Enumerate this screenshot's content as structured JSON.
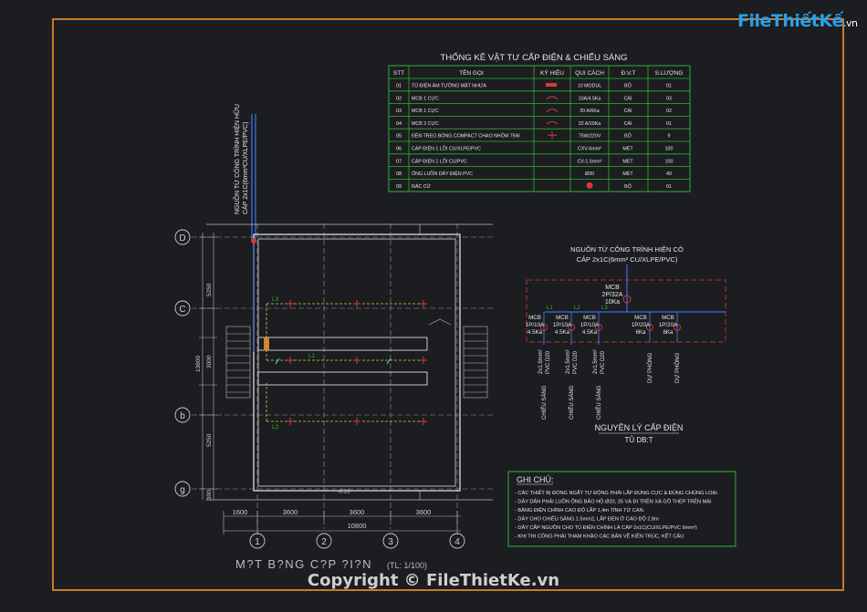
{
  "logo": {
    "brand": "FileThiếtKế",
    "suffix": ".vn"
  },
  "copyright": "Copyright © FileThietKe.vn",
  "table": {
    "title": "THỐNG KÊ VẬT TƯ CẤP ĐIỆN & CHIẾU SÁNG",
    "headers": [
      "STT",
      "TÊN GỌI",
      "KÝ HIỆU",
      "QUI CÁCH",
      "Đ.V.T",
      "S.LƯỢNG"
    ],
    "rows": [
      {
        "stt": "01",
        "name": "TỦ ĐIỆN ÂM TƯỜNG MẶT NHỰA",
        "spec": "10 MODUL",
        "unit": "BỘ",
        "qty": "01"
      },
      {
        "stt": "02",
        "name": "MCB 1 CỰC",
        "spec": "10A/4.5Ka",
        "unit": "CÁI",
        "qty": "03"
      },
      {
        "stt": "03",
        "name": "MCB 1 CỰC",
        "spec": "20 A/6Ka",
        "unit": "CÁI",
        "qty": "02"
      },
      {
        "stt": "04",
        "name": "MCB 2 CỰC",
        "spec": "32 A/10Ka",
        "unit": "CÁI",
        "qty": "01"
      },
      {
        "stt": "05",
        "name": "ĐÈN TREO BÓNG COMPACT CHAO NHÔM 75W",
        "spec": "75W/220V",
        "unit": "BỘ",
        "qty": "9"
      },
      {
        "stt": "06",
        "name": "CÁP ĐIỆN 1 LÕI CU/XLPE/PVC",
        "spec": "CXV-6mm²",
        "unit": "MÉT",
        "qty": "100"
      },
      {
        "stt": "07",
        "name": "CÁP ĐIỆN 1 LÕI CU/PVC",
        "spec": "CV-1.5mm²",
        "unit": "MÉT",
        "qty": "100"
      },
      {
        "stt": "08",
        "name": "ỐNG LUỒN DÂY ĐIỆN PVC",
        "spec": "Ø20",
        "unit": "MÉT",
        "qty": "40"
      },
      {
        "stt": "09",
        "name": "RÁC CỬ",
        "spec": "",
        "unit": "BỘ",
        "qty": "01"
      }
    ]
  },
  "plan": {
    "title": "M?T B?NG C?P ?I?N",
    "scale": "(TL: 1/100)",
    "level": "-0.20",
    "source_note_1": "NGUỒN TỪ CÔNG TRÌNH HIỆN HỮU",
    "source_note_2": "CÁP 2x1C(6mm²CU/XLPE/PVC)",
    "row_axes": [
      "D",
      "C",
      "b",
      "g"
    ],
    "col_axes": [
      "1",
      "2",
      "3",
      "4"
    ],
    "dims_x": [
      "1600",
      "3600",
      "3600",
      "3600"
    ],
    "dim_total_x": "10800",
    "dims_y": [
      "5250",
      "3000",
      "5250",
      "300"
    ],
    "dim_total_y": "13800",
    "circuit_tags": [
      "L3",
      "L1",
      "L2"
    ]
  },
  "schematic": {
    "source_1": "NGUỒN TỪ CÔNG TRÌNH HIỆN CÓ",
    "source_2": "CÁP 2x1C(6mm² CU/XLPE/PVC)",
    "main": [
      "MCB",
      "2P/32A",
      "10Ka"
    ],
    "lines": [
      "L1",
      "L2",
      "L3"
    ],
    "branches": [
      {
        "l1": "MCB",
        "l2": "1P/10A",
        "l3": "4.5Ka",
        "cable": "2x1.5mm²",
        "pipe": "PVC D20",
        "load": "CHIẾU SÁNG"
      },
      {
        "l1": "MCB",
        "l2": "1P/10A",
        "l3": "4.5Ka",
        "cable": "2x1.5mm²",
        "pipe": "PVC D20",
        "load": "CHIẾU SÁNG"
      },
      {
        "l1": "MCB",
        "l2": "1P/10A",
        "l3": "4.5Ka",
        "cable": "2x1.5mm²",
        "pipe": "PVC D20",
        "load": "CHIẾU SÁNG"
      },
      {
        "l1": "MCB",
        "l2": "1P/20A",
        "l3": "6Ka",
        "load": "DỰ PHÒNG"
      },
      {
        "l1": "MCB",
        "l2": "1P/20A",
        "l3": "6Ka",
        "load": "DỰ PHÒNG"
      }
    ],
    "title": "NGUYÊN LÝ CẤP ĐIỆN",
    "subtitle": "TỦ DB:T"
  },
  "notes": {
    "title": "GHI CHÚ:",
    "items": [
      "- CÁC THIẾT BỊ ĐÓNG NGẮT TỰ ĐỘNG PHẢI LẮP ĐÚNG CỰC & ĐÚNG CHỦNG LOẠI.",
      "- DÂY DẪN PHẢI LUỒN ỐNG BẢO HỘ Ø20, 25 VÀ ĐI TRÊN XÀ GỒ THÉP TRÊN MÁI",
      "- BẢNG ĐIỆN CHÍNH CAO ĐỘ LẮP 1,4m TÍNH TỪ CAN.",
      "- DÂY CHO CHIẾU SÁNG 1.5mm2, LẮP ĐÈN Ở CAO ĐỘ 2.8m",
      "- DÂY CẤP NGUỒN CHO TỦ ĐIỆN CHÍNH LÀ CÁP 2x1C(CU/XLPE/PVC 6mm²)",
      "- KHI THI CÔNG PHẢI THAM KHẢO CÁC BẢN VẼ KIẾN TRÚC, KẾT CẤU"
    ]
  },
  "colors": {
    "frame": "#c77a2b",
    "green": "#2fb32f",
    "red": "#d73a3a",
    "blue": "#3f6fe0",
    "yellow": "#d9cf3a",
    "cyan": "#2fc6d0"
  }
}
